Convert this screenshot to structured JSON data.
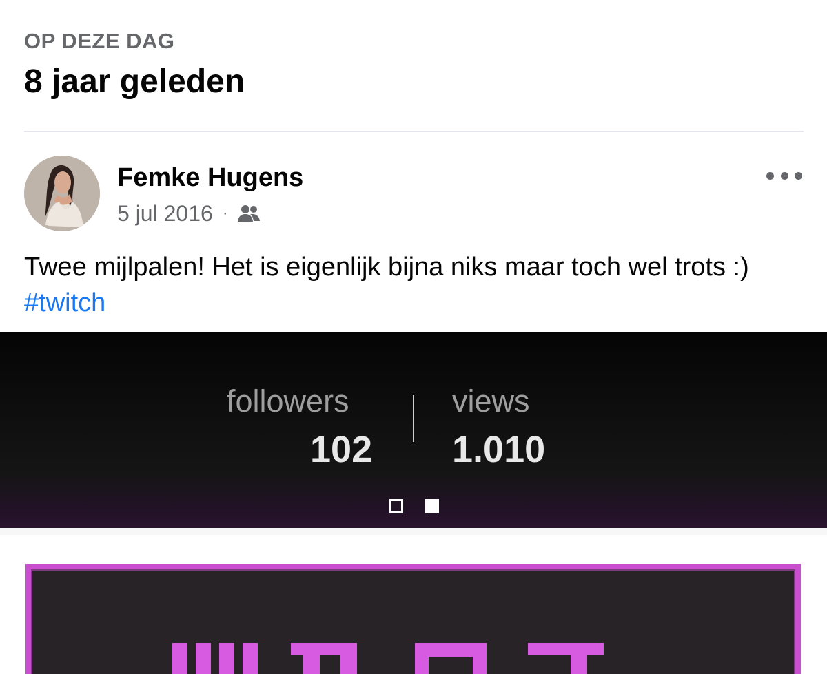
{
  "memory": {
    "eyebrow": "OP DEZE DAG",
    "years_ago": "8 jaar geleden"
  },
  "post": {
    "author": "Femke Hugens",
    "date": "5 jul 2016",
    "separator": "·",
    "audience_icon": "friends-icon",
    "more_icon": "more-options-icon",
    "caption": "Twee mijlpalen! Het is eigenlijk bijna niks maar toch wel trots :) ",
    "hashtag": "#twitch",
    "image": {
      "followers_label": "followers",
      "followers_value": "102",
      "views_label": "views",
      "views_value": "1.010",
      "carousel_position": 1,
      "carousel_total": 2,
      "accent_color": "#c94ed0"
    }
  }
}
